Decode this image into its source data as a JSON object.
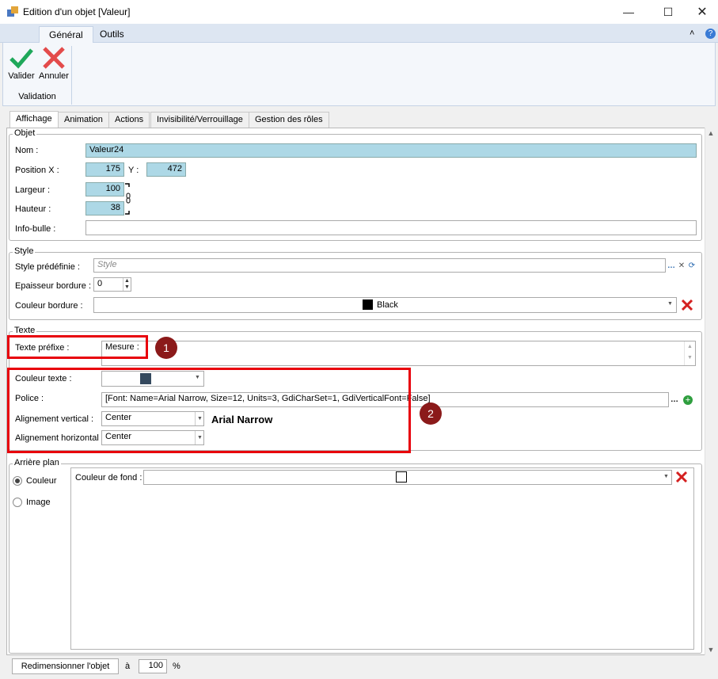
{
  "window": {
    "title": "Edition d'un objet [Valeur]"
  },
  "ribbon": {
    "tabs": [
      "Général",
      "Outils"
    ],
    "validate_label": "Valider",
    "cancel_label": "Annuler",
    "group_label": "Validation"
  },
  "tabs": [
    "Affichage",
    "Animation",
    "Actions",
    "Invisibilité/Verrouillage",
    "Gestion des rôles"
  ],
  "objet": {
    "section": "Objet",
    "name_label": "Nom :",
    "name_value": "Valeur24",
    "posx_label": "Position X :",
    "posx_value": "175",
    "posy_label": "Y :",
    "posy_value": "472",
    "width_label": "Largeur :",
    "width_value": "100",
    "height_label": "Hauteur :",
    "height_value": "38",
    "tooltip_label": "Info-bulle :",
    "tooltip_value": ""
  },
  "style": {
    "section": "Style",
    "predefined_label": "Style prédéfinie :",
    "predefined_placeholder": "Style",
    "border_width_label": "Epaisseur bordure :",
    "border_width_value": "0",
    "border_color_label": "Couleur bordure :",
    "border_color_value": "Black",
    "border_color_hex": "#000000"
  },
  "texte": {
    "section": "Texte",
    "prefix_label": "Texte préfixe :",
    "prefix_value": "Mesure :",
    "color_label": "Couleur texte :",
    "color_hex": "#34495e",
    "font_label": "Police :",
    "font_value": "[Font: Name=Arial Narrow, Size=12, Units=3, GdiCharSet=1, GdiVerticalFont=False]",
    "valign_label": "Alignement vertical :",
    "valign_value": "Center",
    "halign_label": "Alignement horizontal :",
    "halign_value": "Center",
    "font_preview": "Arial Narrow",
    "badge1": "1",
    "badge2": "2"
  },
  "background": {
    "section": "Arrière plan",
    "option_color": "Couleur",
    "option_image": "Image",
    "fill_label": "Couleur de fond :",
    "fill_hex": "#ffffff"
  },
  "bottom": {
    "resize_label": "Redimensionner l'objet",
    "to_label": "à",
    "percent_value": "100",
    "percent_sign": "%"
  }
}
